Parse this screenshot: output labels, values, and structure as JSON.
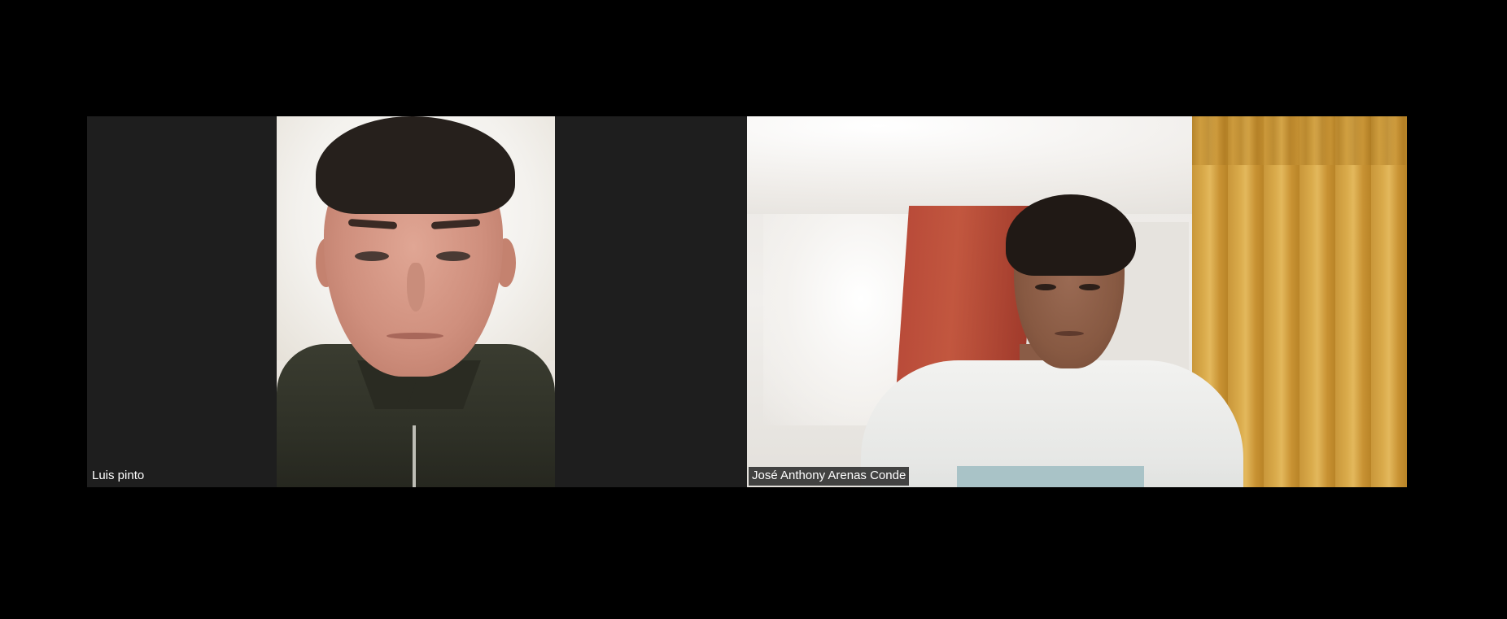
{
  "meeting": {
    "participants": [
      {
        "name": "Luis pinto"
      },
      {
        "name": "José Anthony Arenas Conde"
      }
    ]
  },
  "colors": {
    "background": "#000000",
    "tile_background": "#1e1e1e",
    "label_text": "#ffffff"
  }
}
